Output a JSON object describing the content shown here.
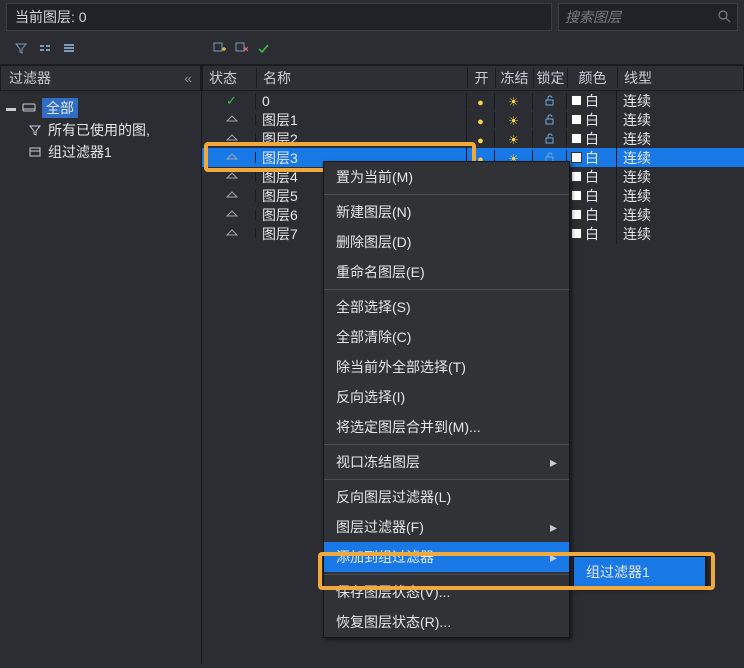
{
  "topbar": {
    "current_layer_prefix": "当前图层:",
    "current_layer_value": "0",
    "search_placeholder": "搜索图层"
  },
  "sidebar": {
    "title": "过滤器",
    "tree": {
      "root": "全部",
      "child1": "所有已使用的图,",
      "child2": "组过滤器1"
    }
  },
  "table": {
    "columns": {
      "state": "状态",
      "name": "名称",
      "on": "开",
      "freeze": "冻结",
      "lock": "锁定",
      "color": "颜色",
      "linetype": "线型"
    },
    "rows": [
      {
        "state": "current",
        "name": "0",
        "color_label": "白",
        "linetype": "连续",
        "selected": false
      },
      {
        "state": "layer",
        "name": "图层1",
        "color_label": "白",
        "linetype": "连续",
        "selected": false
      },
      {
        "state": "layer",
        "name": "图层2",
        "color_label": "白",
        "linetype": "连续",
        "selected": false
      },
      {
        "state": "layer",
        "name": "图层3",
        "color_label": "白",
        "linetype": "连续",
        "selected": true
      },
      {
        "state": "layer",
        "name": "图层4",
        "color_label": "白",
        "linetype": "连续",
        "selected": false
      },
      {
        "state": "layer",
        "name": "图层5",
        "color_label": "白",
        "linetype": "连续",
        "selected": false
      },
      {
        "state": "layer",
        "name": "图层6",
        "color_label": "白",
        "linetype": "连续",
        "selected": false
      },
      {
        "state": "layer",
        "name": "图层7",
        "color_label": "白",
        "linetype": "连续",
        "selected": false
      }
    ]
  },
  "context_menu": {
    "items": [
      {
        "label": "置为当前(M)"
      },
      {
        "sep": true
      },
      {
        "label": "新建图层(N)"
      },
      {
        "label": "删除图层(D)"
      },
      {
        "label": "重命名图层(E)"
      },
      {
        "sep": true
      },
      {
        "label": "全部选择(S)"
      },
      {
        "label": "全部清除(C)"
      },
      {
        "label": "除当前外全部选择(T)"
      },
      {
        "label": "反向选择(I)"
      },
      {
        "label": "将选定图层合并到(M)..."
      },
      {
        "sep": true
      },
      {
        "label": "视口冻结图层",
        "arrow": true
      },
      {
        "sep": true
      },
      {
        "label": "反向图层过滤器(L)"
      },
      {
        "label": "图层过滤器(F)",
        "arrow": true
      },
      {
        "label": "添加到组过滤器",
        "arrow": true,
        "selected": true
      },
      {
        "sep": true
      },
      {
        "label": "保存图层状态(V)..."
      },
      {
        "label": "恢复图层状态(R)..."
      }
    ]
  },
  "submenu": {
    "item": "组过滤器1"
  }
}
